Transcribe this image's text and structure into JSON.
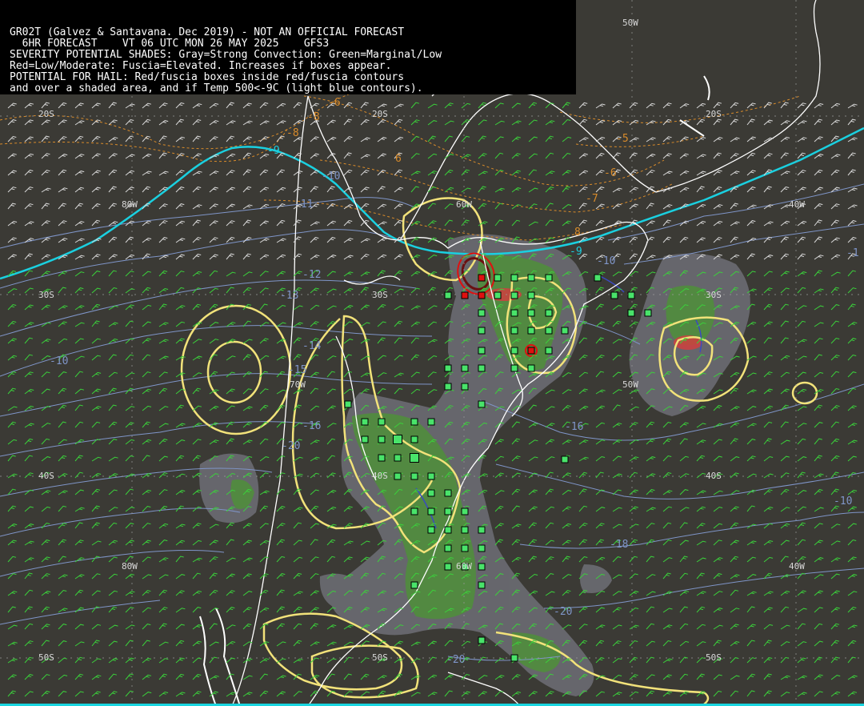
{
  "header": {
    "lines": [
      "GR02T (Galvez & Santavana. Dec 2019) - NOT AN OFFICIAL FORECAST",
      "  6HR FORECAST    VT 06 UTC MON 26 MAY 2025    GFS3",
      "SEVERITY POTENTIAL SHADES: Gray=Strong Convection: Green=Marginal/Low",
      "Red=Low/Moderate: Fuscia=Elevated. Increases if boxes appear.",
      "POTENTIAL FOR HAIL: Red/fuscia boxes inside red/fuscia contours",
      "and over a shaded area, and if Temp 500<-9C (light blue contours)."
    ]
  },
  "grid_labels": {
    "50W_top": "50W",
    "20S_left": "20S",
    "20S_mid": "20S",
    "20S_right": "20S",
    "80W_upper": "80W",
    "60W": "60W",
    "40W_upper": "40W",
    "30S_left": "30S",
    "30S_mid": "30S",
    "30S_right": "30S",
    "70W": "70W",
    "50W_mid": "50W",
    "40S_left": "40S",
    "40S_mid": "40S",
    "40S_right": "40S",
    "80W_lower": "80W",
    "60W_lower": "60W",
    "40W_lower": "40W",
    "50S_left": "50S",
    "50S_mid": "50S",
    "50S_right": "50S"
  },
  "temp_labels": {
    "t_neg10_a": "-10",
    "t_neg11": "-11",
    "t_neg12": "-12",
    "t_neg13": "-13",
    "t_neg14": "-14",
    "t_neg15": "-15",
    "t_neg16": "-16",
    "t_neg18": "-18",
    "t_neg20_a": "-20",
    "t_neg20_b": "-20",
    "t_neg20_c": "-20",
    "t_neg9_a": "-9",
    "t_neg9_b": "-9",
    "t_neg10_b": "-10",
    "t_neg10_c": "-10",
    "t_neg10_d": "-10",
    "t_neg1": "-1",
    "t_neg16b": "-16"
  },
  "orange_labels": {
    "o_neg5": "-5",
    "o_neg6a": "-6",
    "o_neg6b": "-6",
    "o_neg7": "-7",
    "o_neg8a": "-8",
    "o_neg8b": "-8",
    "o_6": "6",
    "o_8": "8"
  },
  "colors": {
    "background": "#3b3a35",
    "coast": "#ffffff",
    "yellow_contour": "#f2e27a",
    "cyan_contour": "#1ad0e0",
    "blue_contour": "#7f95c8",
    "orange_contour": "#d98b2a",
    "green_barb": "#3bd13b",
    "white_barb": "#d8d8d8",
    "gray_shade": "#6b6c72",
    "green_shade": "#4f8f3a",
    "red_shade": "#d04040",
    "box_green": "#49e36a",
    "box_red": "#e01010"
  }
}
